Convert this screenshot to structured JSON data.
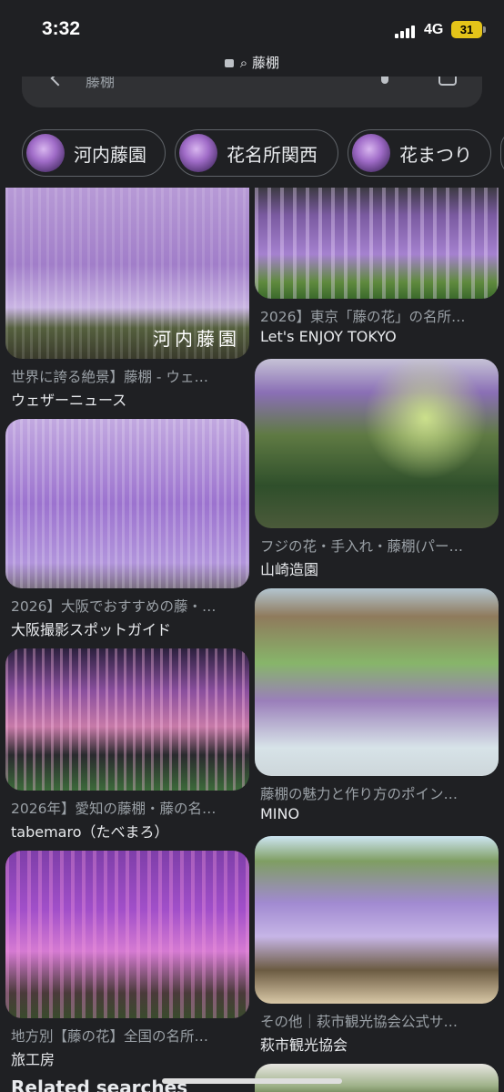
{
  "status": {
    "time": "3:32",
    "network": "4G",
    "battery": "31"
  },
  "url_bar": {
    "query": "藤棚"
  },
  "search": {
    "query": "藤棚"
  },
  "chips": [
    {
      "label": "河内藤園"
    },
    {
      "label": "花名所関西"
    },
    {
      "label": "花まつり"
    }
  ],
  "results": [
    {
      "caption": "世界に誇る絶景】藤棚 - ウェ…",
      "source": "ウェザーニュース",
      "overlay": "河内藤園"
    },
    {
      "caption": "2026】東京「藤の花」の名所…",
      "source": "Let's ENJOY TOKYO"
    },
    {
      "caption": "フジの花・手入れ・藤棚(パー…",
      "source": "山崎造園"
    },
    {
      "caption": "2026】大阪でおすすめの藤・…",
      "source": "大阪撮影スポットガイド"
    },
    {
      "caption": "藤棚の魅力と作り方のポイン…",
      "source": "MINO"
    },
    {
      "caption": "2026年】愛知の藤棚・藤の名…",
      "source": "tabemaro（たべまろ）"
    },
    {
      "caption": "その他｜萩市観光協会公式サ…",
      "source": "萩市観光協会"
    },
    {
      "caption": "地方別【藤の花】全国の名所…",
      "source": "旅工房"
    }
  ],
  "related": {
    "heading": "Related searches"
  },
  "icons": [
    "lock-icon",
    "search-icon",
    "back-chevron-icon",
    "mic-icon",
    "lens-icon"
  ]
}
